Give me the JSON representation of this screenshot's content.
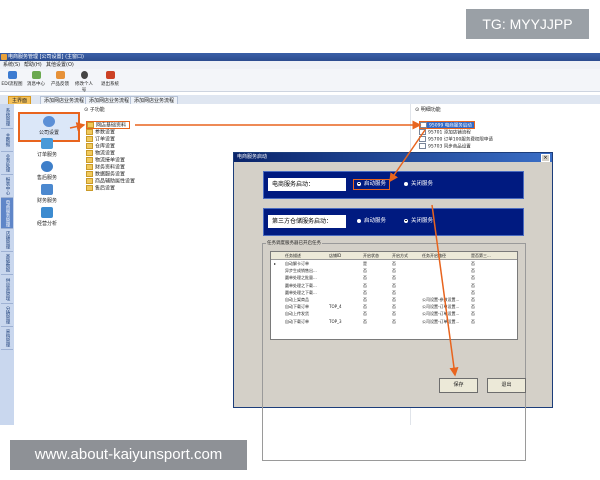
{
  "watermark": {
    "tg": "TG: MYYJJPP",
    "site": "www.about-kaiyunsport.com"
  },
  "window": {
    "title": "电商服务管理 [公司设置] (主窗口)"
  },
  "menu": [
    "系统(S)",
    "帮助(H)",
    "其他设置(O)"
  ],
  "toolbar": [
    {
      "label": "EDI流程图",
      "color": "#3c7bd1"
    },
    {
      "label": "消息中心",
      "color": "#6aa84f"
    },
    {
      "label": "产品反馈",
      "color": "#e69138"
    },
    {
      "label": "修改个人号",
      "color": "#444444"
    },
    {
      "label": "退出系统",
      "color": "#cc4125"
    }
  ],
  "tabs": [
    "主界面",
    "添加网店业务流程",
    "添加网店业务流程",
    "添加网店业务流程"
  ],
  "vtabs": [
    "系统管理",
    "主数据",
    "业务处理",
    "报表中心",
    "电商服务管理",
    "店铺管理",
    "基础数据",
    "供应商管理",
    "分销管理",
    "采购管理"
  ],
  "nav": [
    {
      "label": "公司设置",
      "icon": "gear-icon",
      "color": "#5b8fd6"
    },
    {
      "label": "订单服务",
      "icon": "cart-icon",
      "color": "#4a9ad8"
    },
    {
      "label": "售后服务",
      "icon": "headset-icon",
      "color": "#3f7fc9"
    },
    {
      "label": "财务服务",
      "icon": "finance-icon",
      "color": "#4b88cf"
    },
    {
      "label": "经营分析",
      "icon": "chart-icon",
      "color": "#3c8bd0"
    }
  ],
  "func_pane": {
    "header": "子功能",
    "items": [
      "网店基础资料",
      "参数设置",
      "订单设置",
      "仓库设置",
      "物流设置",
      "物流接单设置",
      "财务资料设置",
      "数据服务设置",
      "商品辅助属性设置",
      "售后设置"
    ]
  },
  "detail_pane": {
    "header": "明细功能",
    "items": [
      "95099  电商服务启动",
      "95701  添加店铺流程",
      "95700  订单100服务费权限申请",
      "95703  同步商品设置"
    ]
  },
  "dialog": {
    "title": "电商服务启动",
    "close": "×",
    "service_label": "电商服务启动：",
    "service_on": "启动服务",
    "service_off": "关闭服务",
    "third_label": "第三方仓储服务启动：",
    "third_on": "启动服务",
    "third_off": "关闭服务",
    "group_label": "任务调度服务器已开启任务",
    "columns": [
      "任务描述",
      "店铺ID",
      "开启状态",
      "开启方式",
      "任务开启路径",
      "是否第三..."
    ],
    "rows": [
      [
        "自动解卡订单",
        "",
        "是",
        "否",
        "",
        "否"
      ],
      [
        "异步生成销售出...",
        "",
        "否",
        "否",
        "",
        "否"
      ],
      [
        "圆单处理之批量...",
        "",
        "否",
        "否",
        "",
        "否"
      ],
      [
        "圆单处理之下载...",
        "",
        "否",
        "否",
        "",
        "否"
      ],
      [
        "圆单处理之下载...",
        "",
        "否",
        "否",
        "",
        "否"
      ],
      [
        "自动上架商品",
        "",
        "否",
        "否",
        "公司设置-参数设置...",
        "否"
      ],
      [
        "自动下载订单",
        "TOP_4",
        "否",
        "否",
        "公司设置-订单设置...",
        "否"
      ],
      [
        "自动上传发货",
        "",
        "否",
        "否",
        "公司设置-订单设置...",
        "否"
      ],
      [
        "自动下载订单",
        "TOP_3",
        "否",
        "否",
        "公司设置-订单设置...",
        "否"
      ]
    ],
    "save": "保存",
    "exit": "退出"
  }
}
